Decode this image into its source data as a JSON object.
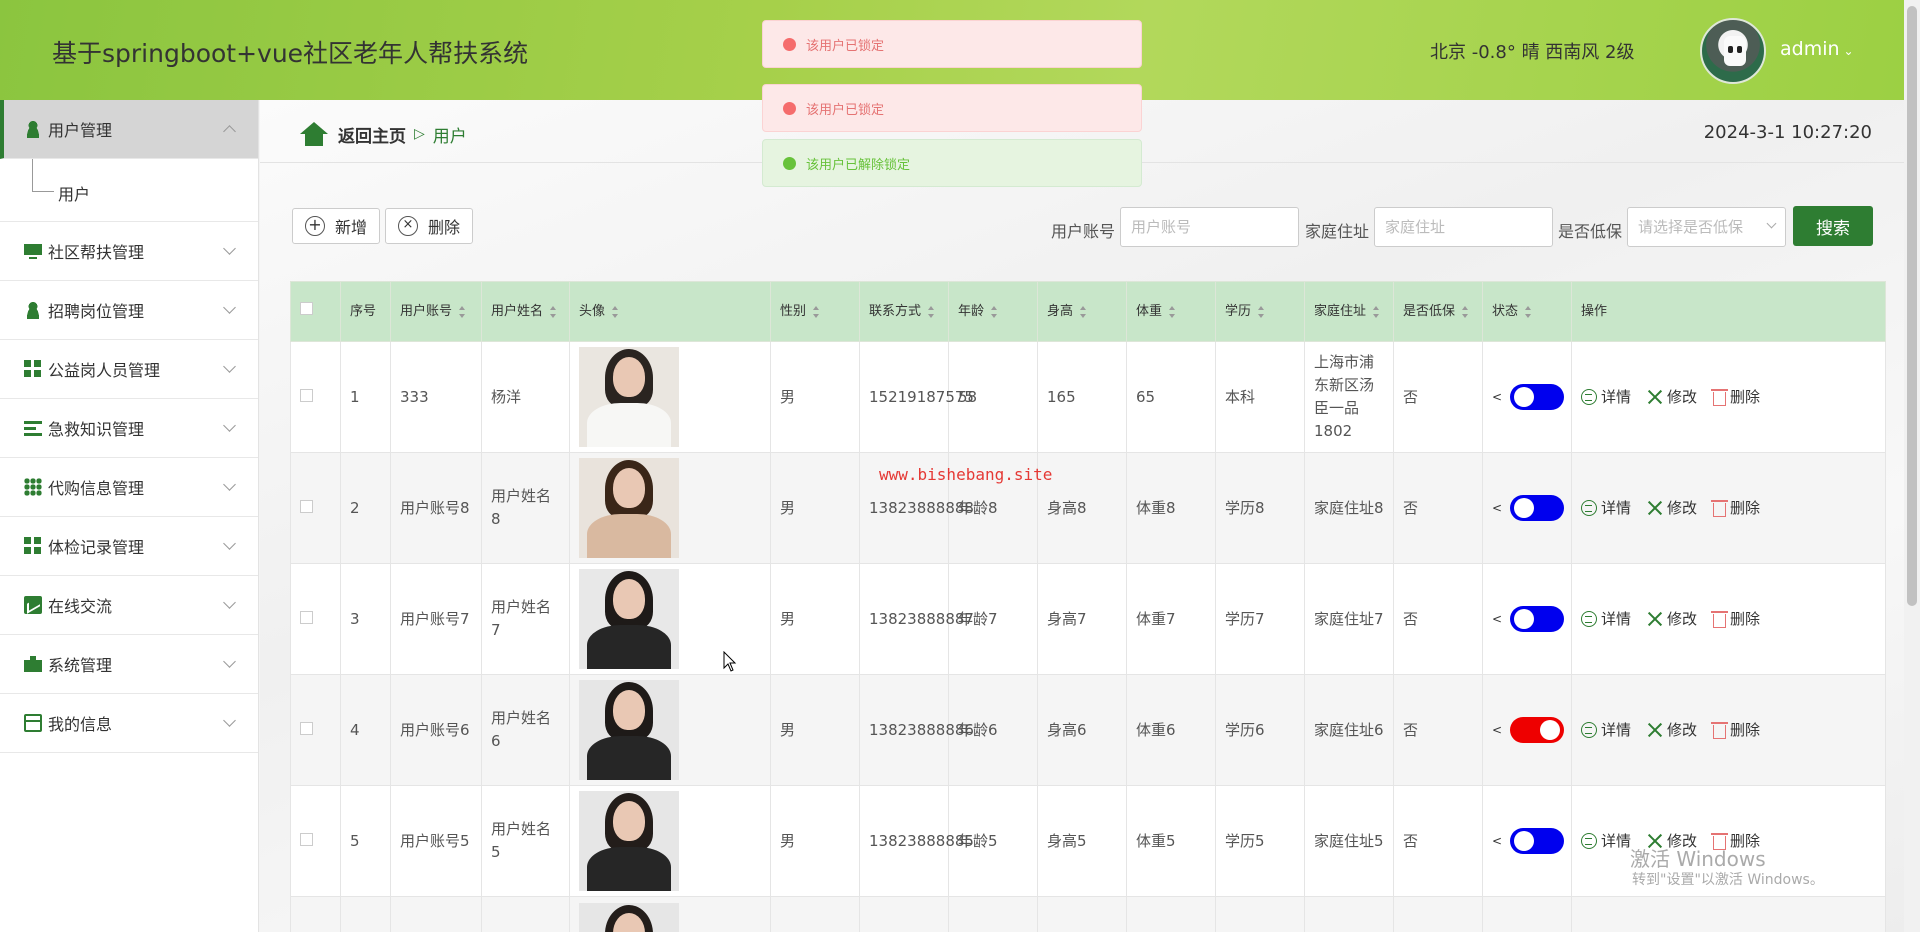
{
  "header": {
    "title": "基于springboot+vue社区老年人帮扶系统",
    "weather": "北京  -0.8°  晴  西南风  2级",
    "username": "admin"
  },
  "toasts": [
    {
      "type": "error",
      "text": "该用户已锁定"
    },
    {
      "type": "error",
      "text": "该用户已锁定"
    },
    {
      "type": "success",
      "text": "该用户已解除锁定"
    }
  ],
  "sidebar": {
    "items": [
      {
        "label": "用户管理",
        "icon": "user-icon"
      },
      {
        "label": "社区帮扶管理",
        "icon": "monitor-icon"
      },
      {
        "label": "招聘岗位管理",
        "icon": "user-icon"
      },
      {
        "label": "公益岗人员管理",
        "icon": "grid-icon"
      },
      {
        "label": "急救知识管理",
        "icon": "list-icon"
      },
      {
        "label": "代购信息管理",
        "icon": "grid9-icon"
      },
      {
        "label": "体检记录管理",
        "icon": "grid-icon"
      },
      {
        "label": "在线交流",
        "icon": "chart-icon"
      },
      {
        "label": "系统管理",
        "icon": "briefcase-icon"
      },
      {
        "label": "我的信息",
        "icon": "card-icon"
      }
    ],
    "subitem": "用户"
  },
  "breadcrumb": {
    "home": "返回主页",
    "current": "用户"
  },
  "datetime": "2024-3-1 10:27:20",
  "toolbar": {
    "add": "新增",
    "delete": "删除"
  },
  "search": {
    "account_label": "用户账号",
    "account_placeholder": "用户账号",
    "address_label": "家庭住址",
    "address_placeholder": "家庭住址",
    "lowincome_label": "是否低保",
    "lowincome_placeholder": "请选择是否低保",
    "button": "搜索"
  },
  "table": {
    "headers": [
      "序号",
      "用户账号",
      "用户姓名",
      "头像",
      "性别",
      "联系方式",
      "年龄",
      "身高",
      "体重",
      "学历",
      "家庭住址",
      "是否低保",
      "状态",
      "操作"
    ],
    "ops": {
      "detail": "详情",
      "edit": "修改",
      "delete": "删除"
    },
    "rows": [
      {
        "no": "1",
        "account": "333",
        "name": "杨洋",
        "gender": "男",
        "phone": "15219187575",
        "age": "58",
        "height": "165",
        "weight": "65",
        "edu": "本科",
        "address": "上海市浦东新区汤臣一品1802",
        "lowincome": "否",
        "locked": false
      },
      {
        "no": "2",
        "account": "用户账号8",
        "name": "用户姓名8",
        "gender": "男",
        "phone": "13823888888",
        "age": "年龄8",
        "height": "身高8",
        "weight": "体重8",
        "edu": "学历8",
        "address": "家庭住址8",
        "lowincome": "否",
        "locked": false
      },
      {
        "no": "3",
        "account": "用户账号7",
        "name": "用户姓名7",
        "gender": "男",
        "phone": "13823888887",
        "age": "年龄7",
        "height": "身高7",
        "weight": "体重7",
        "edu": "学历7",
        "address": "家庭住址7",
        "lowincome": "否",
        "locked": false
      },
      {
        "no": "4",
        "account": "用户账号6",
        "name": "用户姓名6",
        "gender": "男",
        "phone": "13823888886",
        "age": "年龄6",
        "height": "身高6",
        "weight": "体重6",
        "edu": "学历6",
        "address": "家庭住址6",
        "lowincome": "否",
        "locked": true
      },
      {
        "no": "5",
        "account": "用户账号5",
        "name": "用户姓名5",
        "gender": "男",
        "phone": "13823888885",
        "age": "年龄5",
        "height": "身高5",
        "weight": "体重5",
        "edu": "学历5",
        "address": "家庭住址5",
        "lowincome": "否",
        "locked": false
      }
    ]
  },
  "watermark": "www.bishebang.site",
  "windows_activation": {
    "line1": "激活 Windows",
    "line2": "转到\"设置\"以激活 Windows。"
  },
  "colors": {
    "primary": "#2e7d32",
    "header_green": "#a6d04a",
    "switch_on": "#0000ee",
    "switch_locked": "#ee0000"
  }
}
